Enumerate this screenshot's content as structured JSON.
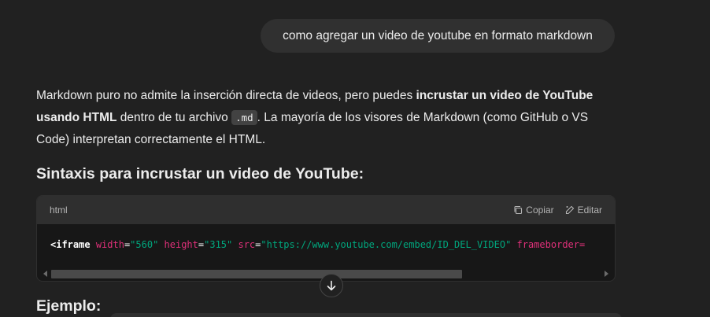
{
  "user_message": "como agregar un video de youtube en formato markdown",
  "answer": {
    "p1_text1": "Markdown puro no admite la inserción directa de videos, pero puedes ",
    "p1_bold1": "incrustar un video de YouTube usando HTML",
    "p1_text2": " dentro de tu archivo ",
    "p1_code": ".md",
    "p1_text3": ". La mayoría de los visores de Markdown (como GitHub o VS Code) interpretan correctamente el HTML."
  },
  "heading_syntax": "Sintaxis para incrustar un video de YouTube:",
  "code_block": {
    "language": "html",
    "copy_label": "Copiar",
    "edit_label": "Editar",
    "tokens": {
      "tag_open": "<iframe",
      "attr1": "width",
      "eq": "=",
      "val1": "\"560\"",
      "attr2": "height",
      "val2": "\"315\"",
      "attr3": "src",
      "val3": "\"https://www.youtube.com/embed/ID_DEL_VIDEO\"",
      "attr4": "frameborder="
    }
  },
  "heading_example": "Ejemplo:",
  "colors": {
    "background": "#212121",
    "bubble": "#303030",
    "code_bg": "#171717",
    "attr": "#df3079",
    "string": "#00a67d"
  }
}
